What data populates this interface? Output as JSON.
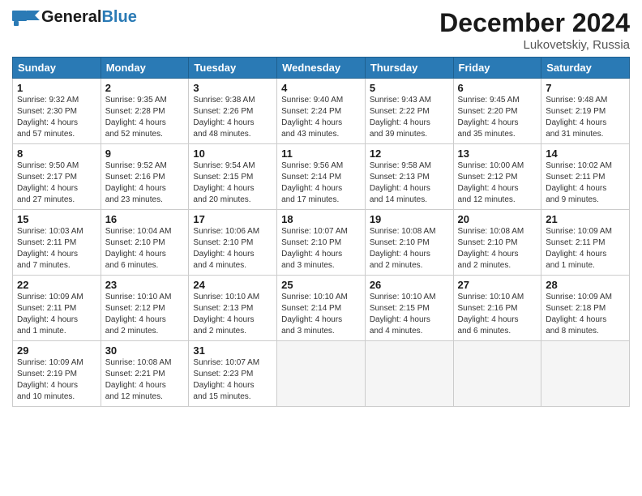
{
  "header": {
    "logo_general": "General",
    "logo_blue": "Blue",
    "month_title": "December 2024",
    "location": "Lukovetskiy, Russia"
  },
  "columns": [
    "Sunday",
    "Monday",
    "Tuesday",
    "Wednesday",
    "Thursday",
    "Friday",
    "Saturday"
  ],
  "weeks": [
    [
      {
        "day": "1",
        "info": "Sunrise: 9:32 AM\nSunset: 2:30 PM\nDaylight: 4 hours\nand 57 minutes."
      },
      {
        "day": "2",
        "info": "Sunrise: 9:35 AM\nSunset: 2:28 PM\nDaylight: 4 hours\nand 52 minutes."
      },
      {
        "day": "3",
        "info": "Sunrise: 9:38 AM\nSunset: 2:26 PM\nDaylight: 4 hours\nand 48 minutes."
      },
      {
        "day": "4",
        "info": "Sunrise: 9:40 AM\nSunset: 2:24 PM\nDaylight: 4 hours\nand 43 minutes."
      },
      {
        "day": "5",
        "info": "Sunrise: 9:43 AM\nSunset: 2:22 PM\nDaylight: 4 hours\nand 39 minutes."
      },
      {
        "day": "6",
        "info": "Sunrise: 9:45 AM\nSunset: 2:20 PM\nDaylight: 4 hours\nand 35 minutes."
      },
      {
        "day": "7",
        "info": "Sunrise: 9:48 AM\nSunset: 2:19 PM\nDaylight: 4 hours\nand 31 minutes."
      }
    ],
    [
      {
        "day": "8",
        "info": "Sunrise: 9:50 AM\nSunset: 2:17 PM\nDaylight: 4 hours\nand 27 minutes."
      },
      {
        "day": "9",
        "info": "Sunrise: 9:52 AM\nSunset: 2:16 PM\nDaylight: 4 hours\nand 23 minutes."
      },
      {
        "day": "10",
        "info": "Sunrise: 9:54 AM\nSunset: 2:15 PM\nDaylight: 4 hours\nand 20 minutes."
      },
      {
        "day": "11",
        "info": "Sunrise: 9:56 AM\nSunset: 2:14 PM\nDaylight: 4 hours\nand 17 minutes."
      },
      {
        "day": "12",
        "info": "Sunrise: 9:58 AM\nSunset: 2:13 PM\nDaylight: 4 hours\nand 14 minutes."
      },
      {
        "day": "13",
        "info": "Sunrise: 10:00 AM\nSunset: 2:12 PM\nDaylight: 4 hours\nand 12 minutes."
      },
      {
        "day": "14",
        "info": "Sunrise: 10:02 AM\nSunset: 2:11 PM\nDaylight: 4 hours\nand 9 minutes."
      }
    ],
    [
      {
        "day": "15",
        "info": "Sunrise: 10:03 AM\nSunset: 2:11 PM\nDaylight: 4 hours\nand 7 minutes."
      },
      {
        "day": "16",
        "info": "Sunrise: 10:04 AM\nSunset: 2:10 PM\nDaylight: 4 hours\nand 6 minutes."
      },
      {
        "day": "17",
        "info": "Sunrise: 10:06 AM\nSunset: 2:10 PM\nDaylight: 4 hours\nand 4 minutes."
      },
      {
        "day": "18",
        "info": "Sunrise: 10:07 AM\nSunset: 2:10 PM\nDaylight: 4 hours\nand 3 minutes."
      },
      {
        "day": "19",
        "info": "Sunrise: 10:08 AM\nSunset: 2:10 PM\nDaylight: 4 hours\nand 2 minutes."
      },
      {
        "day": "20",
        "info": "Sunrise: 10:08 AM\nSunset: 2:10 PM\nDaylight: 4 hours\nand 2 minutes."
      },
      {
        "day": "21",
        "info": "Sunrise: 10:09 AM\nSunset: 2:11 PM\nDaylight: 4 hours\nand 1 minute."
      }
    ],
    [
      {
        "day": "22",
        "info": "Sunrise: 10:09 AM\nSunset: 2:11 PM\nDaylight: 4 hours\nand 1 minute."
      },
      {
        "day": "23",
        "info": "Sunrise: 10:10 AM\nSunset: 2:12 PM\nDaylight: 4 hours\nand 2 minutes."
      },
      {
        "day": "24",
        "info": "Sunrise: 10:10 AM\nSunset: 2:13 PM\nDaylight: 4 hours\nand 2 minutes."
      },
      {
        "day": "25",
        "info": "Sunrise: 10:10 AM\nSunset: 2:14 PM\nDaylight: 4 hours\nand 3 minutes."
      },
      {
        "day": "26",
        "info": "Sunrise: 10:10 AM\nSunset: 2:15 PM\nDaylight: 4 hours\nand 4 minutes."
      },
      {
        "day": "27",
        "info": "Sunrise: 10:10 AM\nSunset: 2:16 PM\nDaylight: 4 hours\nand 6 minutes."
      },
      {
        "day": "28",
        "info": "Sunrise: 10:09 AM\nSunset: 2:18 PM\nDaylight: 4 hours\nand 8 minutes."
      }
    ],
    [
      {
        "day": "29",
        "info": "Sunrise: 10:09 AM\nSunset: 2:19 PM\nDaylight: 4 hours\nand 10 minutes."
      },
      {
        "day": "30",
        "info": "Sunrise: 10:08 AM\nSunset: 2:21 PM\nDaylight: 4 hours\nand 12 minutes."
      },
      {
        "day": "31",
        "info": "Sunrise: 10:07 AM\nSunset: 2:23 PM\nDaylight: 4 hours\nand 15 minutes."
      },
      {
        "day": "",
        "info": ""
      },
      {
        "day": "",
        "info": ""
      },
      {
        "day": "",
        "info": ""
      },
      {
        "day": "",
        "info": ""
      }
    ]
  ]
}
